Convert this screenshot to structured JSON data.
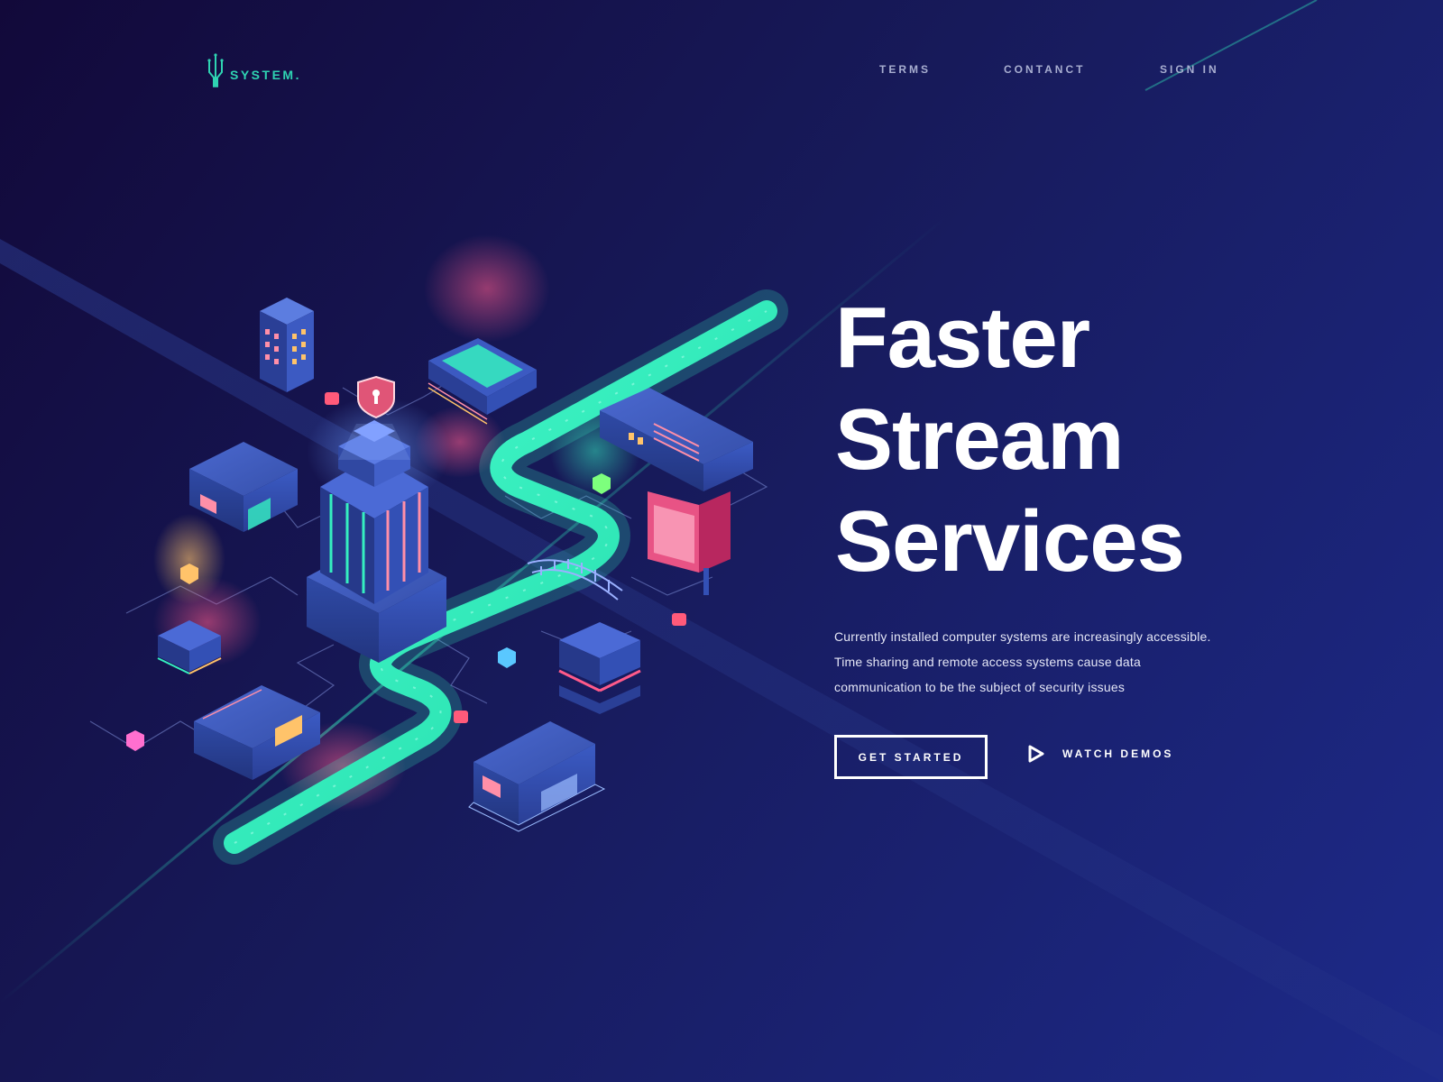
{
  "brand": {
    "name": "SYSTEM.",
    "logo_icon": "circuit-trident-icon",
    "accent_color": "#2fd3b2"
  },
  "nav": {
    "items": [
      {
        "label": "TERMS"
      },
      {
        "label": "CONTANCT"
      },
      {
        "label": "SIGN IN"
      }
    ]
  },
  "hero": {
    "title_lines": [
      "Faster",
      "Stream",
      "Services"
    ],
    "description_lines": [
      "Currently installed computer systems are increasingly accessible.",
      "Time sharing and remote access systems cause data",
      "communication to be the subject of security issues"
    ],
    "primary_button": "GET STARTED",
    "secondary_button": {
      "label": "WATCH DEMOS",
      "icon": "play-icon"
    }
  },
  "illustration": {
    "subject": "isometric-smart-city",
    "icons": [
      "shield-keyhole-icon",
      "skyscraper-icon",
      "data-stream-road-icon"
    ]
  },
  "colors": {
    "background_start": "#12093a",
    "background_end": "#1d2a8a",
    "stream": "#35f0c0",
    "building": "#3d57b8",
    "glow_pink": "#ff5a8a",
    "glow_amber": "#ffc36a"
  }
}
